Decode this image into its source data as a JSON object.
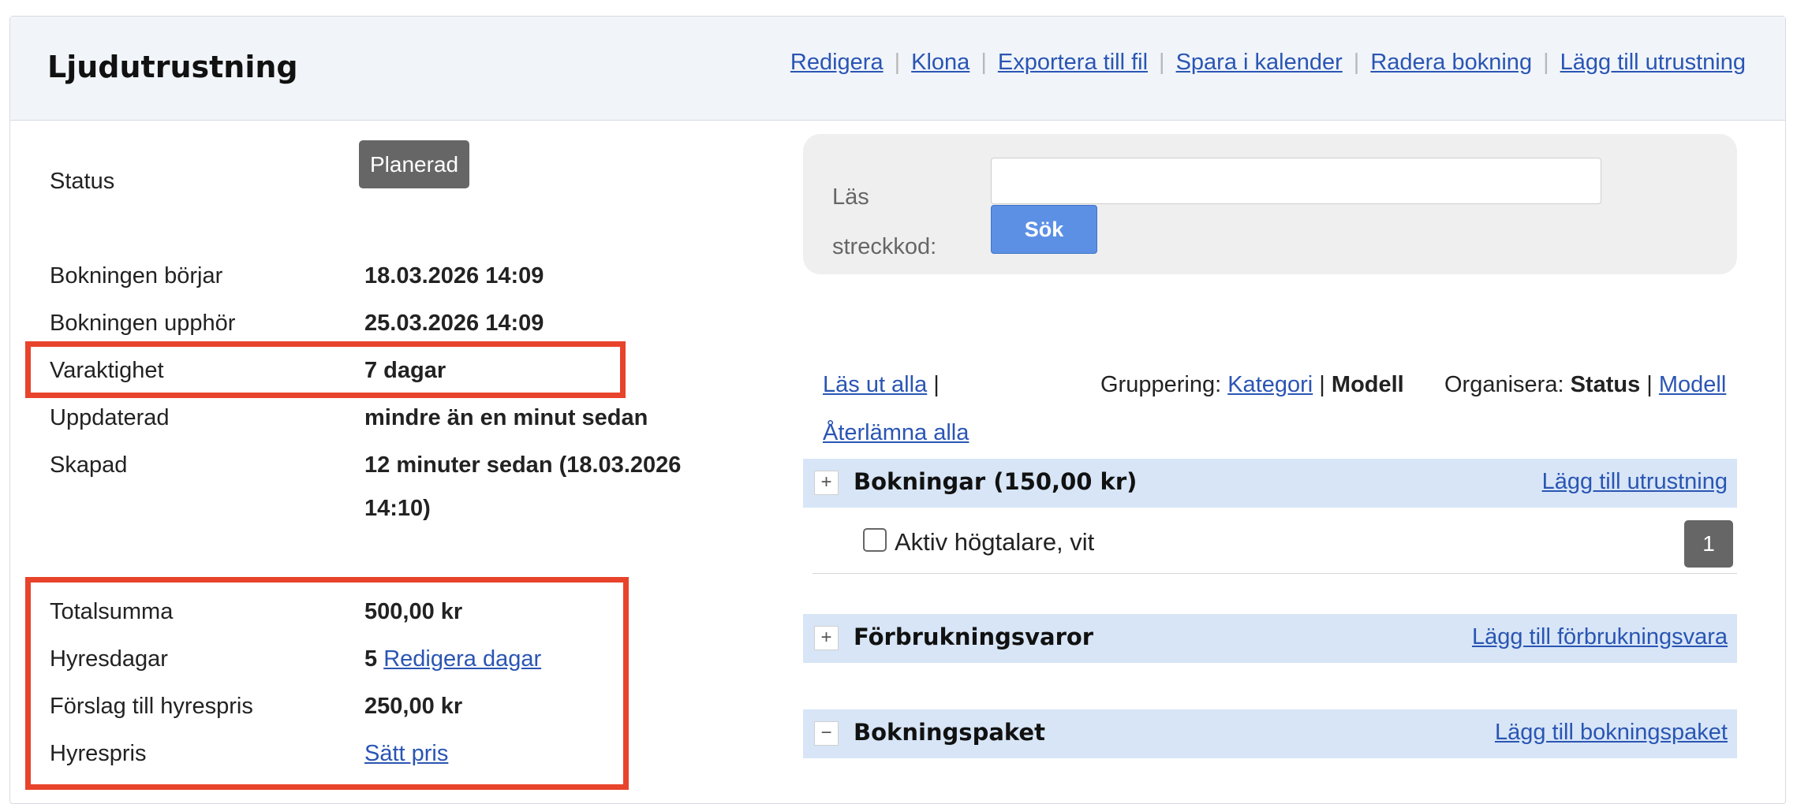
{
  "header": {
    "title": "Ljudutrustning",
    "actions": [
      "Redigera",
      "Klona",
      "Exportera till fil",
      "Spara i kalender",
      "Radera bokning",
      "Lägg till utrustning"
    ],
    "separator": "|"
  },
  "details": {
    "status": {
      "label": "Status",
      "value": "Planerad"
    },
    "starts": {
      "label": "Bokningen börjar",
      "value": "18.03.2026 14:09"
    },
    "ends": {
      "label": "Bokningen upphör",
      "value": "25.03.2026 14:09"
    },
    "duration": {
      "label": "Varaktighet",
      "value": "7 dagar"
    },
    "updated": {
      "label": "Uppdaterad",
      "value": "mindre än en minut sedan"
    },
    "created": {
      "label": "Skapad",
      "value_line1": "12 minuter sedan (18.03.2026",
      "value_line2": "14:10)"
    }
  },
  "pricing": {
    "total": {
      "label": "Totalsumma",
      "value": "500,00 kr"
    },
    "rental_days": {
      "label": "Hyresdagar",
      "value": "5",
      "link": "Redigera dagar"
    },
    "suggested": {
      "label": "Förslag till hyrespris",
      "value": "250,00 kr"
    },
    "rental_price": {
      "label": "Hyrespris",
      "link": "Sätt pris"
    }
  },
  "barcode": {
    "label_line1": "Läs",
    "label_line2": "streckkod:",
    "input_value": "",
    "button": "Sök"
  },
  "toolbar": {
    "checkout_all": "Läs ut alla",
    "bar": "|",
    "return_all": "Återlämna alla",
    "grouping_label": "Gruppering:",
    "grouping_category": "Kategori",
    "grouping_model": "Modell",
    "organize_label": "Organisera:",
    "organize_status": "Status",
    "organize_model": "Modell"
  },
  "sections": {
    "bookings": {
      "toggle": "+",
      "title": "Bokningar (150,00 kr)",
      "link": "Lägg till utrustning"
    },
    "consumables": {
      "toggle": "+",
      "title": "Förbrukningsvaror",
      "link": "Lägg till förbrukningsvara"
    },
    "packages": {
      "toggle": "−",
      "title": "Bokningspaket",
      "link": "Lägg till bokningspaket"
    }
  },
  "items": [
    {
      "name": "Aktiv högtalare, vit",
      "quantity": "1",
      "checked": false
    }
  ],
  "colors": {
    "highlight": "#e8432b",
    "link": "#2a55b3",
    "header_bg": "#f1f5fa",
    "section_bg": "#d7e5f6",
    "search_button": "#5b90e5",
    "badge": "#666666"
  }
}
